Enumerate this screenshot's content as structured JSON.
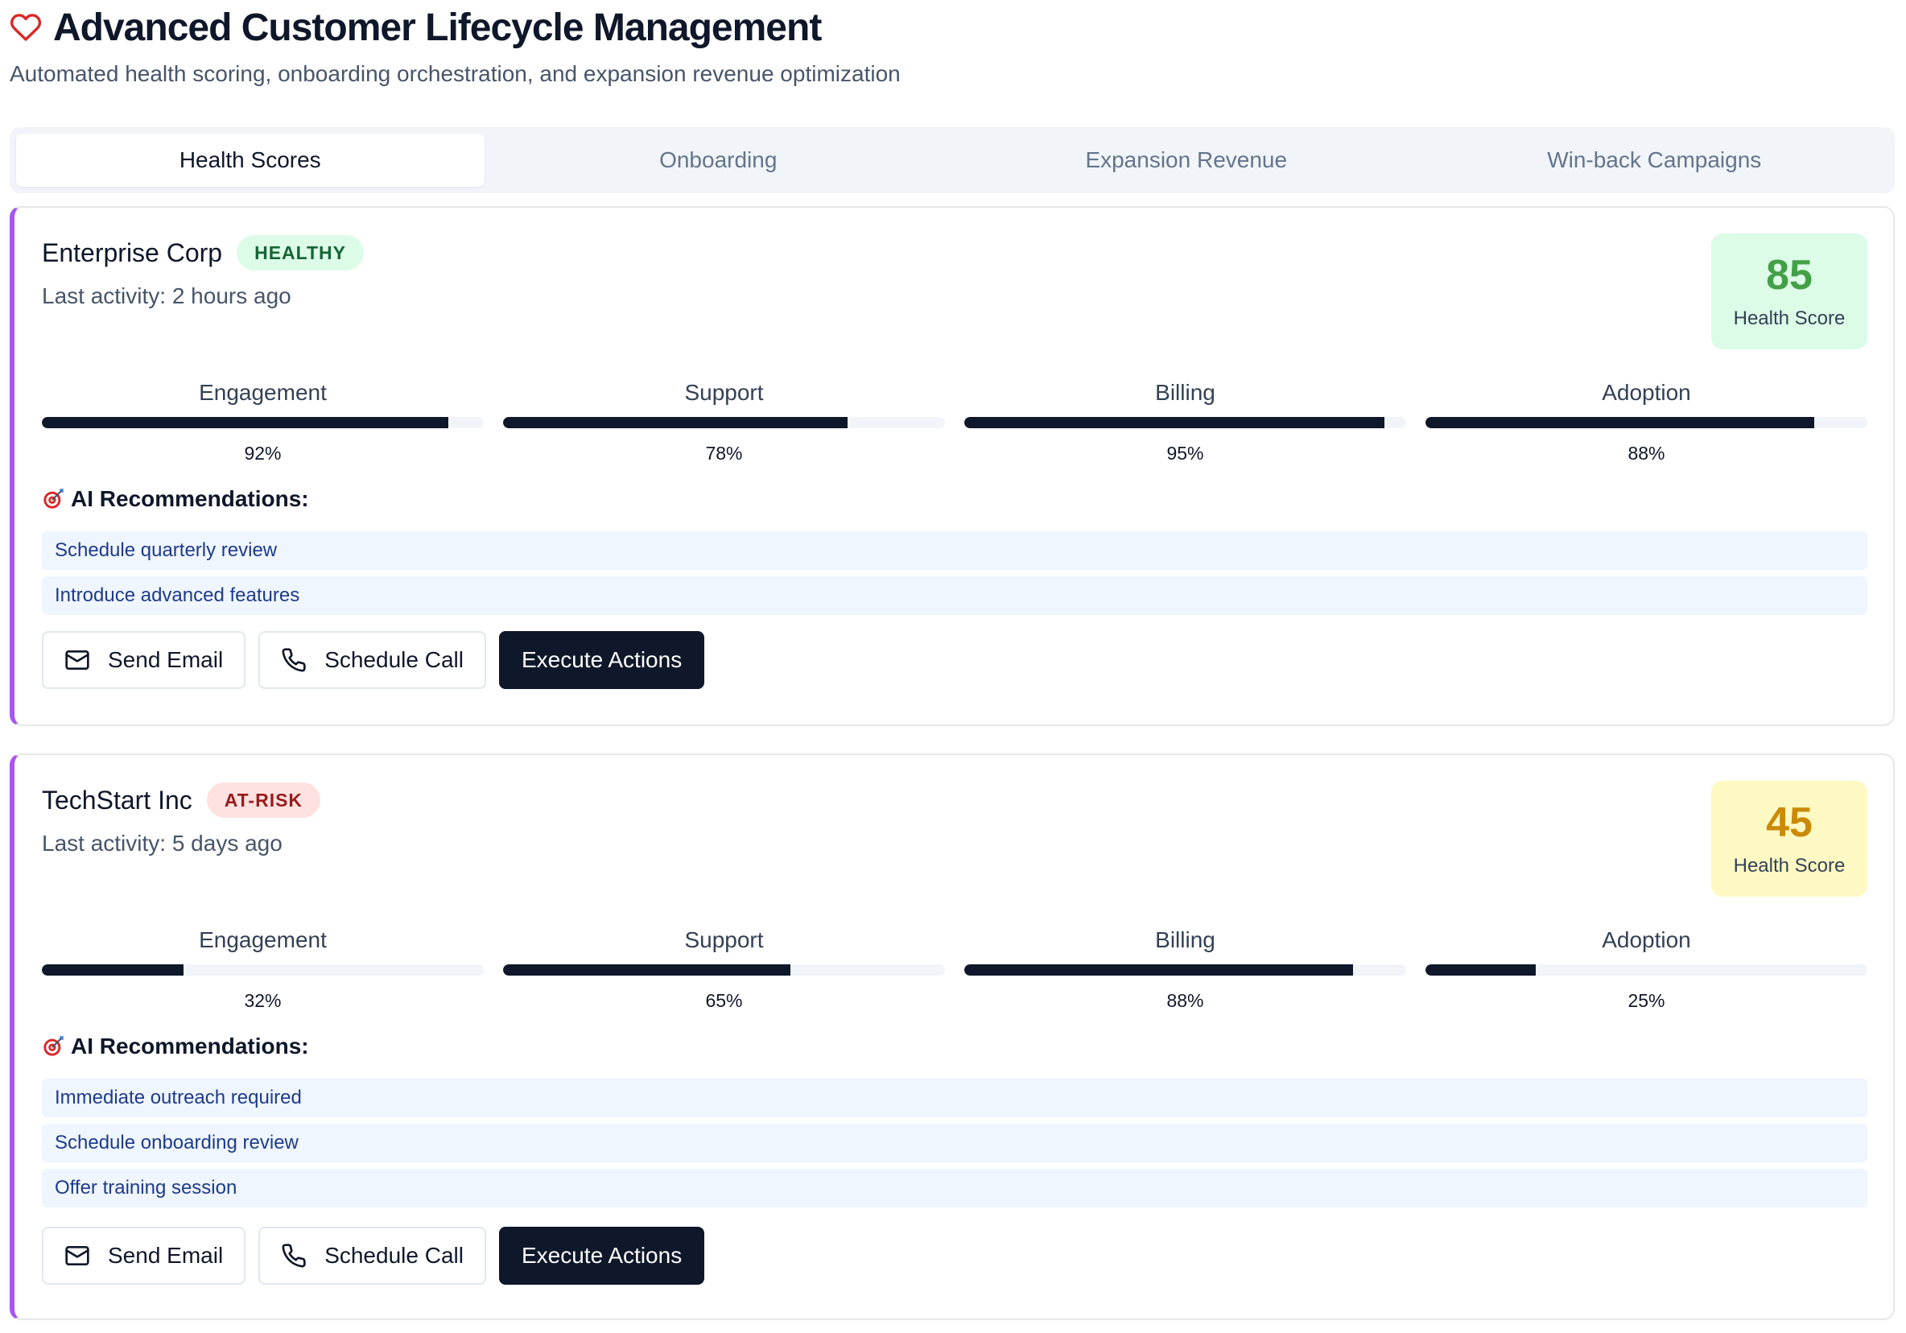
{
  "header": {
    "title": "Advanced Customer Lifecycle Management",
    "subtitle": "Automated health scoring, onboarding orchestration, and expansion revenue optimization",
    "icon": "heart-icon",
    "icon_color": "#dc2626"
  },
  "tabs": [
    {
      "label": "Health Scores",
      "active": true
    },
    {
      "label": "Onboarding",
      "active": false
    },
    {
      "label": "Expansion Revenue",
      "active": false
    },
    {
      "label": "Win-back Campaigns",
      "active": false
    }
  ],
  "customers": [
    {
      "name": "Enterprise Corp",
      "status": "HEALTHY",
      "last_activity": "Last activity: 2 hours ago",
      "score": "85",
      "score_label": "Health Score",
      "metrics": [
        {
          "label": "Engagement",
          "value": "92%",
          "fraction": 0.92
        },
        {
          "label": "Support",
          "value": "78%",
          "fraction": 0.78
        },
        {
          "label": "Billing",
          "value": "95%",
          "fraction": 0.95
        },
        {
          "label": "Adoption",
          "value": "88%",
          "fraction": 0.88
        }
      ],
      "rec_title": "AI Recommendations:",
      "recommendations": [
        "Schedule quarterly review",
        "Introduce advanced features"
      ],
      "actions": {
        "email": "Send Email",
        "call": "Schedule Call",
        "execute": "Execute Actions"
      }
    },
    {
      "name": "TechStart Inc",
      "status": "AT-RISK",
      "last_activity": "Last activity: 5 days ago",
      "score": "45",
      "score_label": "Health Score",
      "metrics": [
        {
          "label": "Engagement",
          "value": "32%",
          "fraction": 0.32
        },
        {
          "label": "Support",
          "value": "65%",
          "fraction": 0.65
        },
        {
          "label": "Billing",
          "value": "88%",
          "fraction": 0.88
        },
        {
          "label": "Adoption",
          "value": "25%",
          "fraction": 0.25
        }
      ],
      "rec_title": "AI Recommendations:",
      "recommendations": [
        "Immediate outreach required",
        "Schedule onboarding review",
        "Offer training session"
      ],
      "actions": {
        "email": "Send Email",
        "call": "Schedule Call",
        "execute": "Execute Actions"
      }
    }
  ],
  "colors": {
    "accent_border": "#a855f7",
    "healthy_bg": "#dcfce7",
    "risk_bg": "#fee2e2",
    "score_green": "#43a047",
    "score_yellow": "#ca8a04"
  }
}
